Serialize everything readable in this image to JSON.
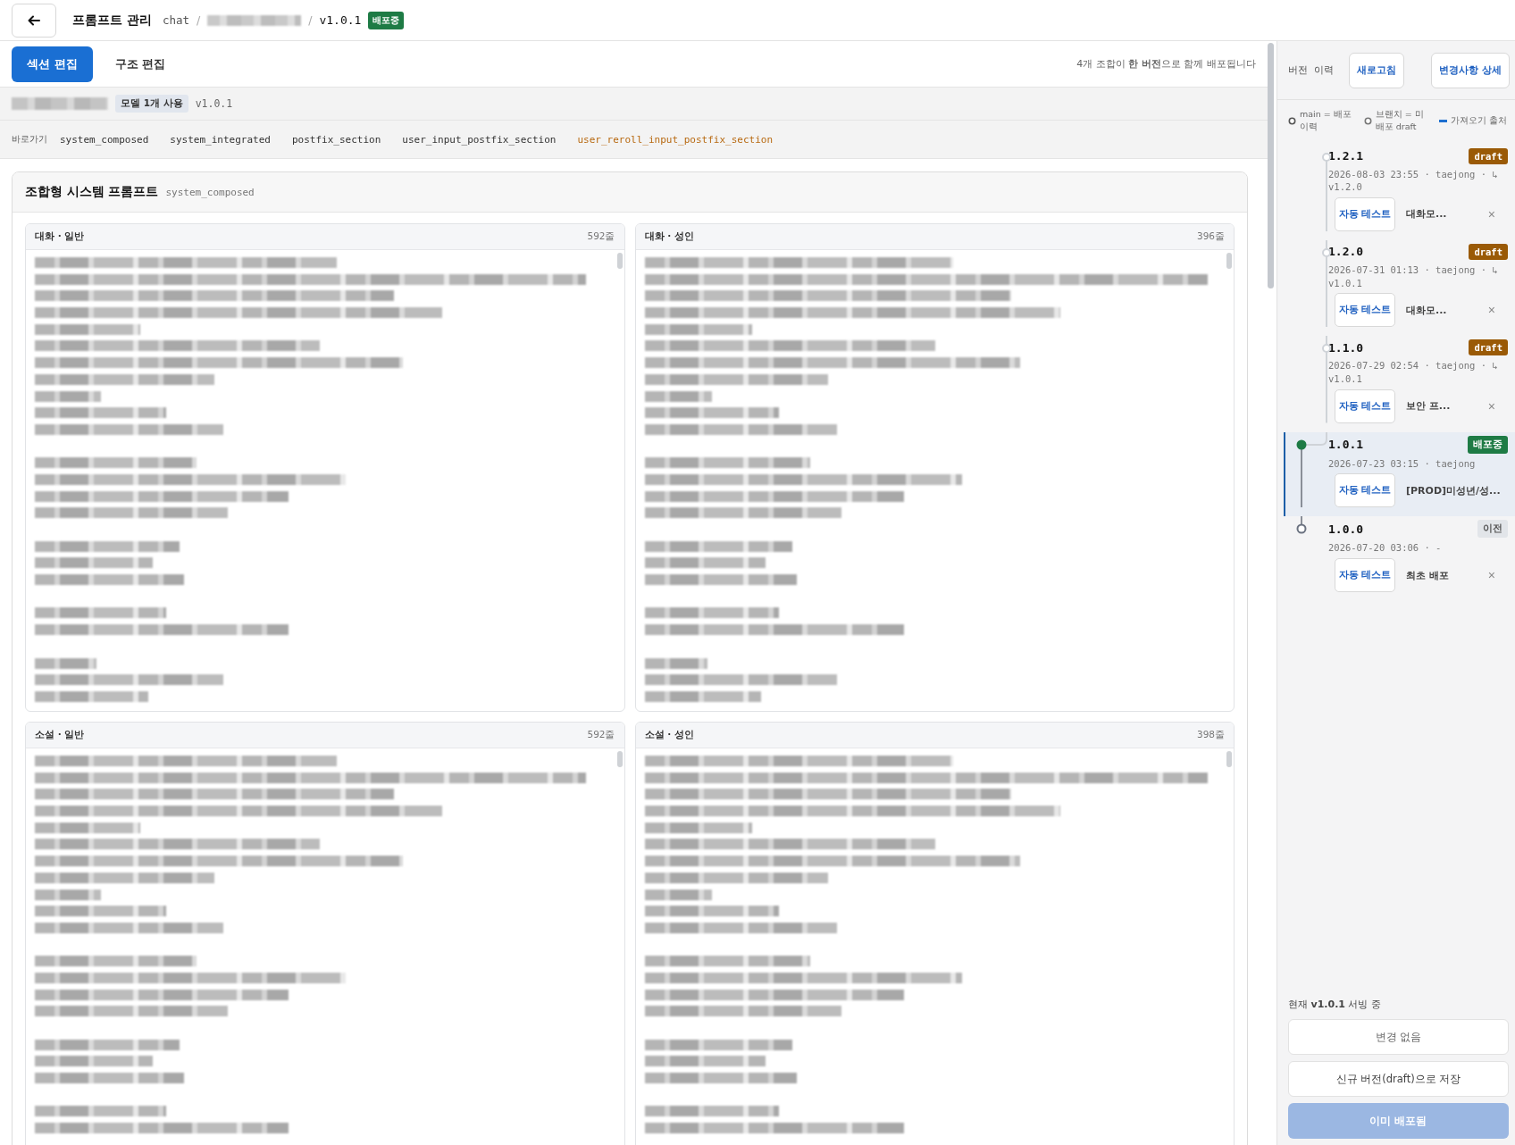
{
  "header": {
    "title": "프롬프트 관리",
    "breadcrumb": [
      {
        "kind": "text",
        "label": "chat"
      },
      {
        "kind": "separator",
        "label": "/"
      },
      {
        "kind": "redacted"
      },
      {
        "kind": "separator",
        "label": "/"
      },
      {
        "kind": "version",
        "label": "v1.0.1"
      }
    ],
    "status_badge": "배포중"
  },
  "tabs": [
    {
      "label": "섹션 편집",
      "selected": true
    },
    {
      "label": "구조 편집",
      "selected": false
    }
  ],
  "deploy_note": "4개 조합이 **한 버전**으로 함께 배포됩니다",
  "model_row": {
    "badge": "모델 1개 사용",
    "version": "v1.0.1"
  },
  "shortcuts": {
    "label": "바로가기",
    "items": [
      {
        "label": "system_composed",
        "selected": false
      },
      {
        "label": "system_integrated",
        "selected": false
      },
      {
        "label": "postfix_section",
        "selected": false
      },
      {
        "label": "user_input_postfix_section",
        "selected": false
      },
      {
        "label": "user_reroll_input_postfix_section",
        "selected": true
      }
    ]
  },
  "section": {
    "title": "조합형 시스템 프롬프트",
    "key": "system_composed",
    "panels": [
      {
        "title": "대화 · 일반",
        "count": "592줄"
      },
      {
        "title": "대화 · 성인",
        "count": "396줄"
      },
      {
        "title": "소설 · 일반",
        "count": "592줄"
      },
      {
        "title": "소설 · 성인",
        "count": "398줄"
      }
    ]
  },
  "sidebar": {
    "title": "버전 이력",
    "buttons": [
      "새로고침",
      "변경사항 상세"
    ],
    "legend": [
      {
        "kind": "main",
        "label": "main = 배포 이력"
      },
      {
        "kind": "branch",
        "label": "브랜치 = 미배포 draft"
      },
      {
        "kind": "source",
        "label": "가져오기 출처"
      }
    ],
    "versions": [
      {
        "version": "1.2.1",
        "kind": "branch",
        "badge": {
          "kind": "draft",
          "label": "draft"
        },
        "meta": "2026-08-03 23:55 · taejong · ↳ v1.2.0",
        "test_button": "자동 테스트",
        "note": "대화모...",
        "removable": true,
        "remove_label": "×",
        "selected": false
      },
      {
        "version": "1.2.0",
        "kind": "branch",
        "badge": {
          "kind": "draft",
          "label": "draft"
        },
        "meta": "2026-07-31 01:13 · taejong · ↳ v1.0.1",
        "test_button": "자동 테스트",
        "note": "대화모...",
        "removable": true,
        "remove_label": "×",
        "selected": false
      },
      {
        "version": "1.1.0",
        "kind": "branch",
        "badge": {
          "kind": "draft",
          "label": "draft"
        },
        "meta": "2026-07-29 02:54 · taejong · ↳ v1.0.1",
        "test_button": "자동 테스트",
        "note": "보안 프...",
        "removable": true,
        "remove_label": "×",
        "selected": false
      },
      {
        "version": "1.0.1",
        "kind": "main",
        "badge": {
          "kind": "deployed",
          "label": "배포중"
        },
        "meta": "2026-07-23 03:15 · taejong",
        "test_button": "자동 테스트",
        "note": "[PROD]미성년/성...",
        "removable": false,
        "selected": true
      },
      {
        "version": "1.0.0",
        "kind": "main",
        "badge": {
          "kind": "previous",
          "label": "이전"
        },
        "meta": "2026-07-20 03:06 · -",
        "test_button": "자동 테스트",
        "note": "최초 배포",
        "removable": true,
        "remove_label": "×",
        "selected": false
      }
    ],
    "footer": {
      "status": "현재 **v1.0.1** 서빙 중",
      "buttons": [
        {
          "label": "변경 없음",
          "kind": "outline",
          "disabled": true
        },
        {
          "label": "신규 버전(draft)으로 저장",
          "kind": "outline",
          "disabled": false
        },
        {
          "label": "이미 배포됨",
          "kind": "primary",
          "disabled": true
        }
      ]
    }
  }
}
